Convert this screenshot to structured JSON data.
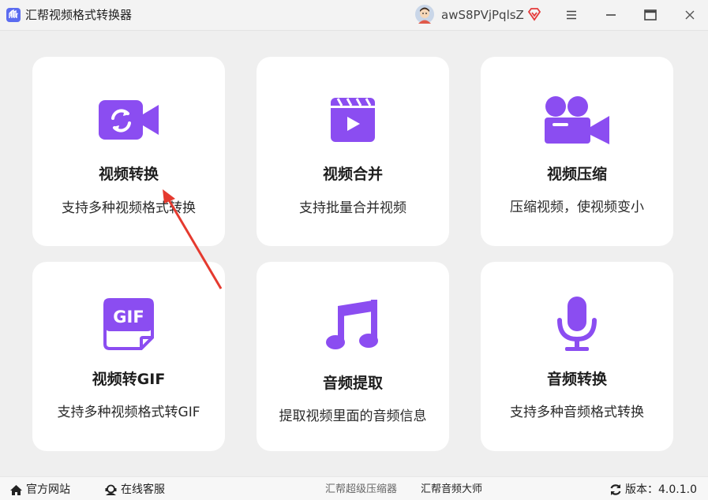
{
  "window": {
    "title": "汇帮视频格式转换器",
    "username": "awS8PVjPqlsZ"
  },
  "cards": [
    {
      "title": "视频转换",
      "desc": "支持多种视频格式转换",
      "icon": "video-convert-icon"
    },
    {
      "title": "视频合并",
      "desc": "支持批量合并视频",
      "icon": "video-merge-icon"
    },
    {
      "title": "视频压缩",
      "desc": "压缩视频，使视频变小",
      "icon": "video-camera-icon"
    },
    {
      "title": "视频转GIF",
      "desc": "支持多种视频格式转GIF",
      "icon": "gif-icon"
    },
    {
      "title": "音频提取",
      "desc": "提取视频里面的音频信息",
      "icon": "music-note-icon"
    },
    {
      "title": "音频转换",
      "desc": "支持多种音频格式转换",
      "icon": "microphone-icon"
    }
  ],
  "statusbar": {
    "website": "官方网站",
    "support": "在线客服",
    "link1": "汇帮超级压缩器",
    "link2": "汇帮音频大师",
    "version": "版本：4.0.1.0"
  },
  "colors": {
    "accent": "#8b4df1",
    "background": "#efefef",
    "annotation_arrow": "#e53a2f"
  }
}
